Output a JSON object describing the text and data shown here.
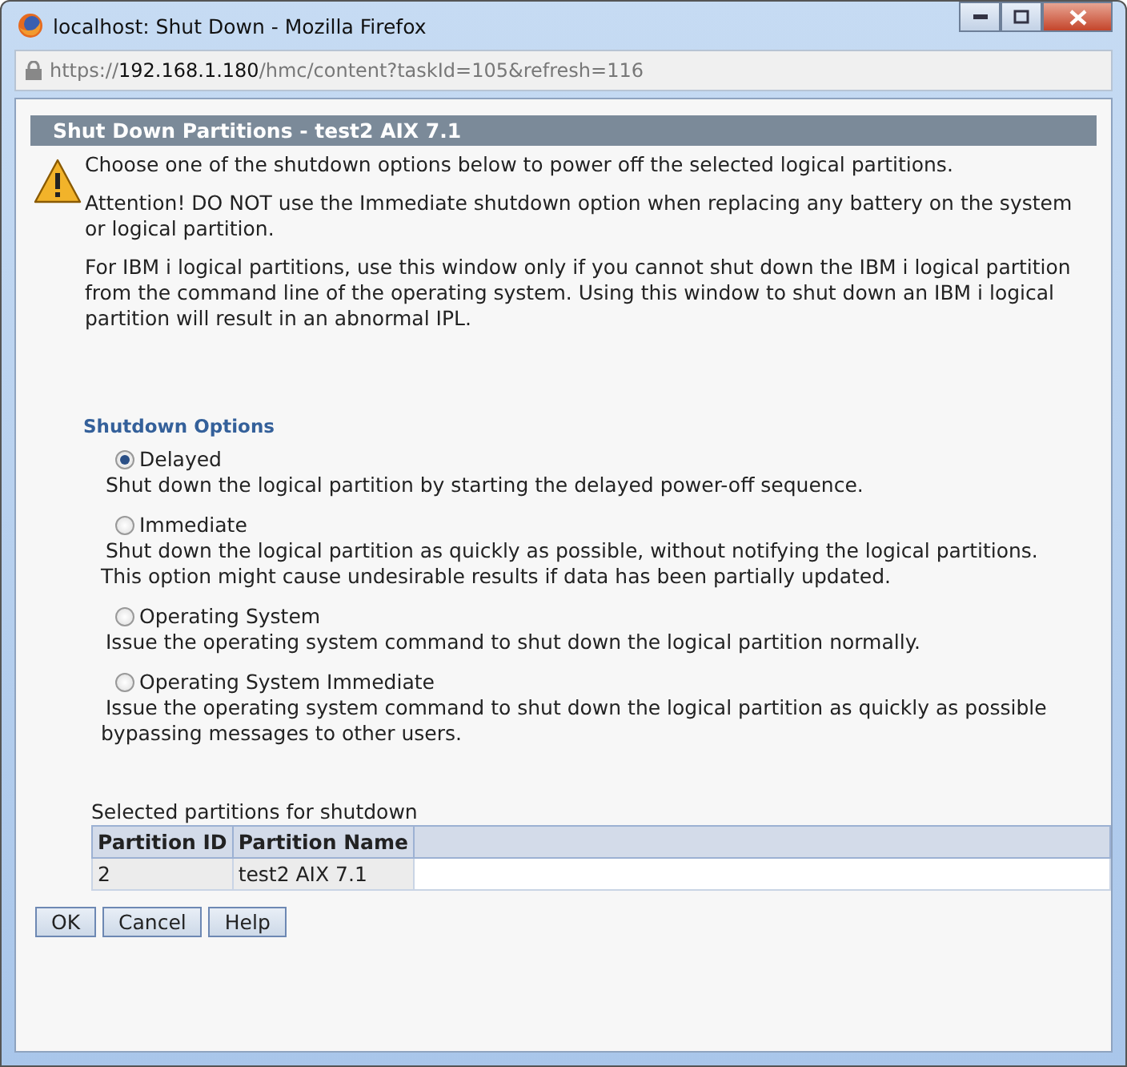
{
  "window": {
    "title": "localhost: Shut Down - Mozilla Firefox"
  },
  "address_bar": {
    "scheme": "https://",
    "host": "192.168.1.180",
    "path": "/hmc/content?taskId=105&refresh=116"
  },
  "panel": {
    "title": "Shut Down Partitions - test2 AIX 7.1"
  },
  "messages": [
    "Choose one of the shutdown options below to power off the selected logical partitions.",
    "Attention! DO NOT use the Immediate shutdown option when replacing any battery on the system or logical partition.",
    "For IBM i logical partitions, use this window only if you cannot shut down the IBM i logical partition from the command line of the operating system. Using this window to shut down an IBM i logical partition will result in an abnormal IPL."
  ],
  "options_heading": "Shutdown Options",
  "options": [
    {
      "label": "Delayed",
      "selected": true,
      "description": [
        "Shut down the logical partition by starting the delayed power-off sequence."
      ]
    },
    {
      "label": "Immediate",
      "selected": false,
      "description": [
        "Shut down the logical partition as quickly as possible, without notifying the logical partitions.",
        "This option might cause undesirable results if data has been partially updated."
      ]
    },
    {
      "label": "Operating System",
      "selected": false,
      "description": [
        "Issue the operating system command to shut down the logical partition normally."
      ]
    },
    {
      "label": "Operating System Immediate",
      "selected": false,
      "description": [
        "Issue the operating system command to shut down the logical partition as quickly as possible",
        "bypassing messages to other users."
      ]
    }
  ],
  "table": {
    "caption": "Selected partitions for shutdown",
    "columns": [
      "Partition ID",
      "Partition Name"
    ],
    "rows": [
      [
        "2",
        "test2 AIX 7.1"
      ]
    ]
  },
  "buttons": [
    "OK",
    "Cancel",
    "Help"
  ]
}
